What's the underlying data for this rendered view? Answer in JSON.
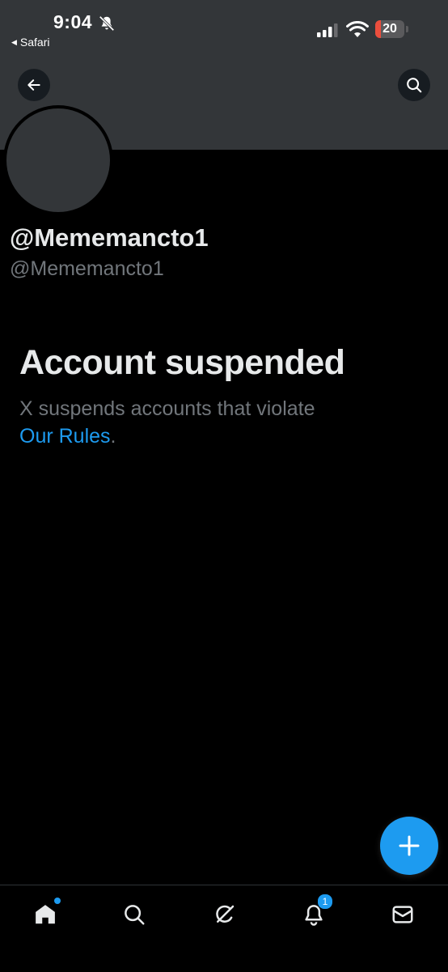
{
  "status_bar": {
    "time": "9:04",
    "back_app_label": "Safari",
    "battery_level": "20",
    "battery_fraction": 0.2,
    "battery_color": "#eb4e3d"
  },
  "header": {
    "back_icon": "arrow-left-icon",
    "search_icon": "search-icon",
    "banner_color": "#333639"
  },
  "profile": {
    "display_name": "@Mememancto1",
    "handle": "@Mememancto1"
  },
  "suspension": {
    "title": "Account suspended",
    "description": "X suspends accounts that violate",
    "link_text": "Our Rules",
    "trailing_punctuation": "."
  },
  "fab": {
    "icon": "plus-icon",
    "color": "#1d9bf0"
  },
  "bottom_nav": {
    "items": [
      {
        "name": "home",
        "icon": "home-icon",
        "active": true
      },
      {
        "name": "search",
        "icon": "search-icon"
      },
      {
        "name": "grok",
        "icon": "grok-icon"
      },
      {
        "name": "notifications",
        "icon": "bell-icon",
        "badge": "1"
      },
      {
        "name": "messages",
        "icon": "mail-icon"
      }
    ]
  },
  "colors": {
    "accent": "#1d9bf0",
    "background": "#000000",
    "secondary_text": "#71767b"
  }
}
